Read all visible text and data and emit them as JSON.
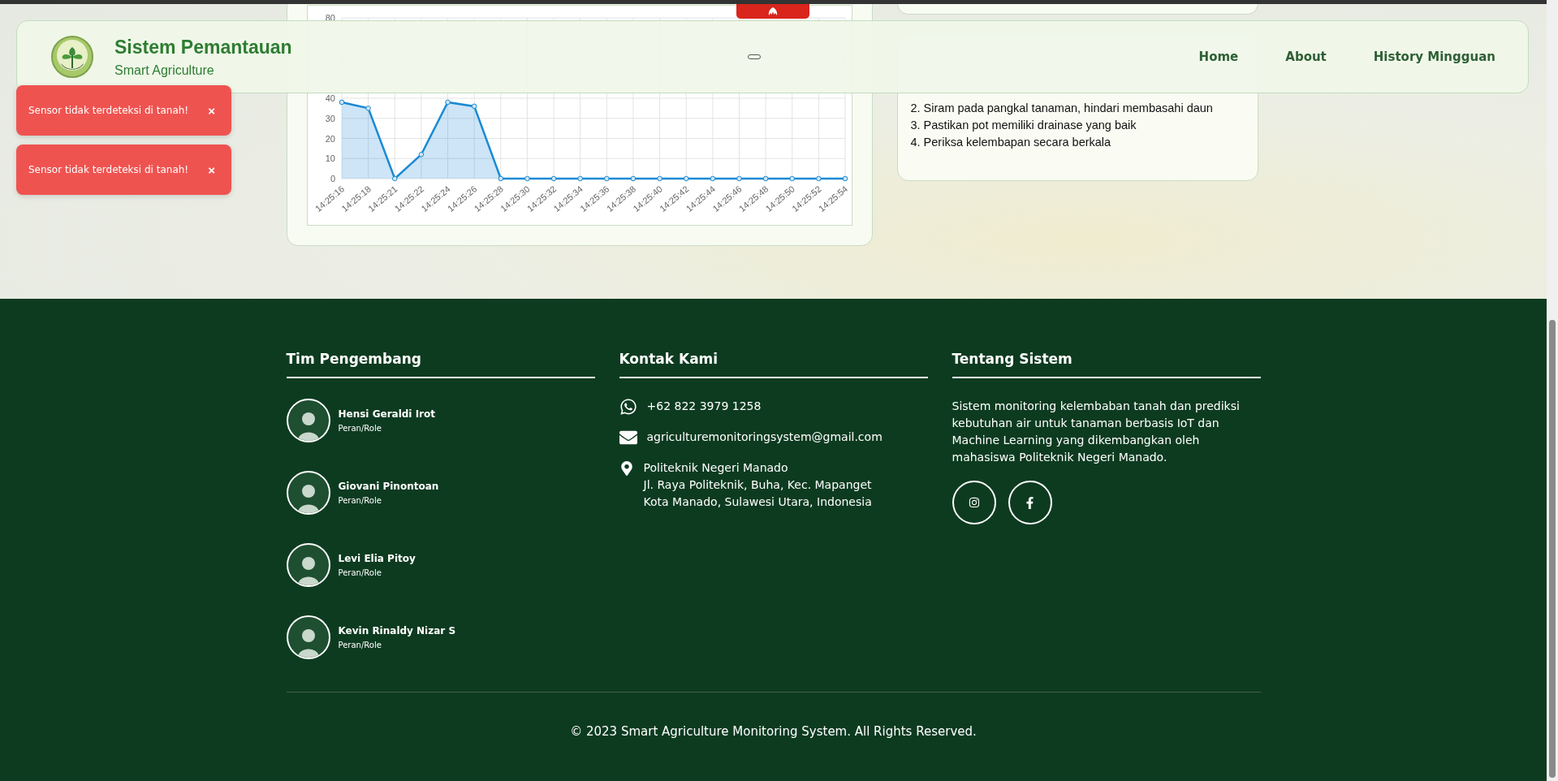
{
  "header": {
    "title": "Sistem Pemantauan",
    "subtitle": "Smart Agriculture",
    "nav": [
      {
        "label": "Home"
      },
      {
        "label": "About"
      },
      {
        "label": "History Mingguan"
      }
    ]
  },
  "toasts": [
    {
      "message": "Sensor tidak terdeteksi di tanah!",
      "close": "×"
    },
    {
      "message": "Sensor tidak terdeteksi di tanah!",
      "close": "×"
    }
  ],
  "chart_card": {
    "chart_data": {
      "type": "area",
      "categories": [
        "14:25:16",
        "14:25:18",
        "14:25:21",
        "14:25:22",
        "14:25:24",
        "14:25:26",
        "14:25:28",
        "14:25:30",
        "14:25:32",
        "14:25:34",
        "14:25:36",
        "14:25:38",
        "14:25:40",
        "14:25:42",
        "14:25:44",
        "14:25:46",
        "14:25:48",
        "14:25:50",
        "14:25:52",
        "14:25:54"
      ],
      "series": [
        {
          "color": "#1a8ad4",
          "values": [
            38,
            35,
            0,
            12,
            38,
            36,
            0,
            0,
            0,
            0,
            0,
            0,
            0,
            0,
            0,
            0,
            0,
            0,
            0,
            0
          ]
        }
      ],
      "ylim": [
        0,
        80
      ],
      "yticks": [
        0,
        10,
        20,
        30,
        40,
        80
      ],
      "grid": true
    }
  },
  "tips": {
    "items": [
      "2. Siram pada pangkal tanaman, hindari membasahi daun",
      "3. Pastikan pot memiliki drainase yang baik",
      "4. Periksa kelembapan secara berkala"
    ]
  },
  "footer": {
    "team": {
      "title": "Tim Pengembang",
      "members": [
        {
          "name": "Hensi Geraldi Irot",
          "role": "Peran/Role"
        },
        {
          "name": "Giovani Pinontoan",
          "role": "Peran/Role"
        },
        {
          "name": "Levi Elia Pitoy",
          "role": "Peran/Role"
        },
        {
          "name": "Kevin Rinaldy Nizar S",
          "role": "Peran/Role"
        }
      ]
    },
    "contact": {
      "title": "Kontak Kami",
      "phone": "+62 822 3979 1258",
      "email": "agriculturemonitoringsystem@gmail.com",
      "address": [
        "Politeknik Negeri Manado",
        "Jl. Raya Politeknik, Buha, Kec. Mapanget",
        "Kota Manado, Sulawesi Utara, Indonesia"
      ]
    },
    "about": {
      "title": "Tentang Sistem",
      "text": "Sistem monitoring kelembaban tanah dan prediksi kebutuhan air untuk tanaman berbasis IoT dan Machine Learning yang dikembangkan oleh mahasiswa Politeknik Negeri Manado."
    },
    "copyright": "© 2023 Smart Agriculture Monitoring System. All Rights Reserved."
  }
}
